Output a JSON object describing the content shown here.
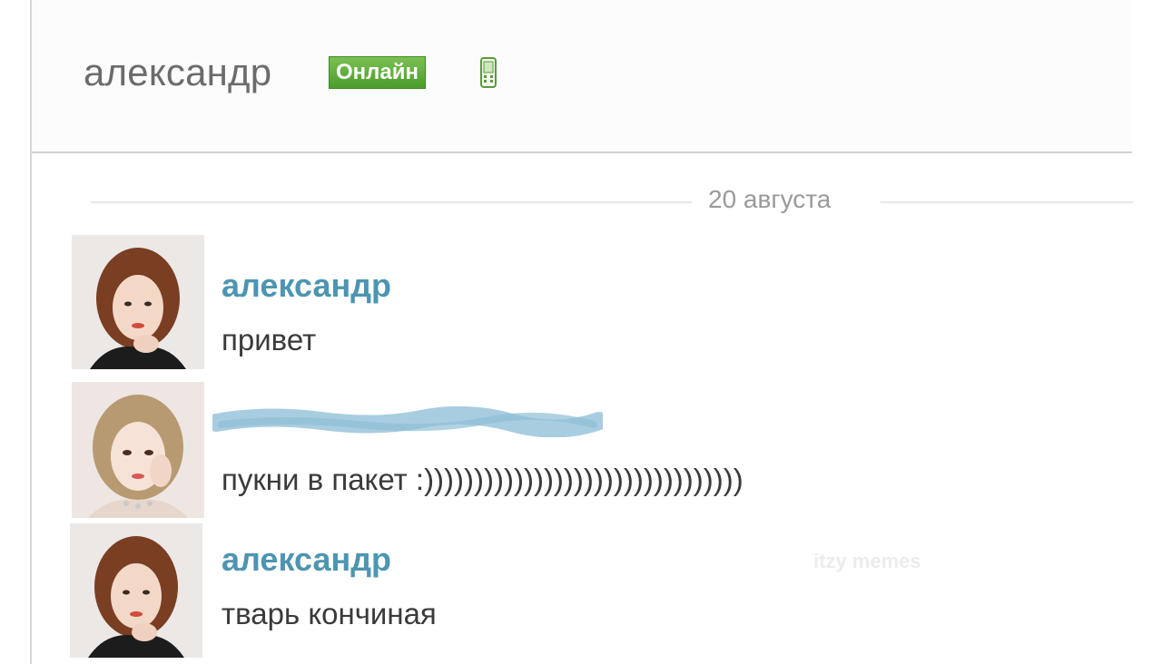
{
  "header": {
    "name": "александр",
    "status_badge": "Онлайн",
    "device_icon": "mobile-phone-icon"
  },
  "date_separator": "20 августа",
  "messages": [
    {
      "author": "александр",
      "text": "привет",
      "avatar": "avatar-1"
    },
    {
      "author": "",
      "author_redacted": true,
      "text": "пукни в пакет :))))))))))))))))))))))))))))))))",
      "avatar": "avatar-2"
    },
    {
      "author": "александр",
      "text": "тварь кончиная",
      "avatar": "avatar-1"
    }
  ],
  "watermark": "itzy memes",
  "colors": {
    "author_name": "#4d95b0",
    "online_badge": "#5aa832",
    "header_name": "#6b6b6b",
    "date_label": "#9a9a9a"
  }
}
